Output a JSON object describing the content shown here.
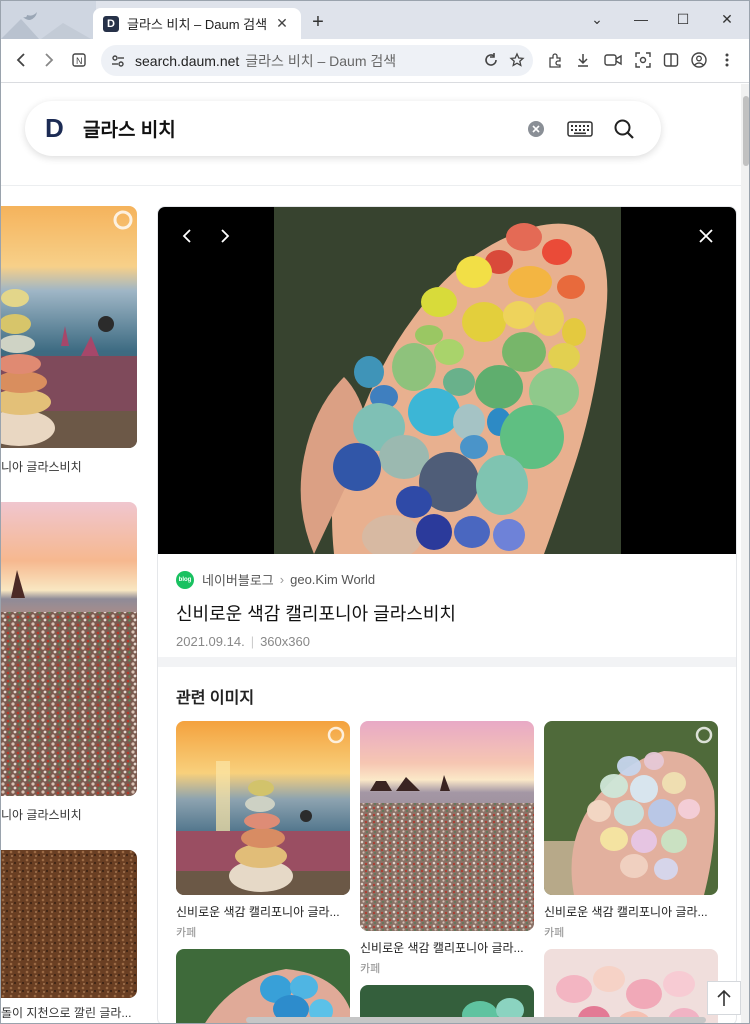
{
  "browser": {
    "tab_title": "글라스 비치 – Daum 검색",
    "tab_favicon_letter": "D",
    "url": "search.daum.net",
    "page_title": "글라스 비치 – Daum 검색",
    "icons": [
      "back-icon",
      "forward-icon",
      "site-icon",
      "reload-icon",
      "bookmark-icon",
      "extensions-icon",
      "download-icon",
      "camera-icon",
      "screenshot-icon",
      "sidebar-icon",
      "profile-icon",
      "menu-icon"
    ]
  },
  "search": {
    "logo": "D",
    "query": "글라스 비치"
  },
  "left_results": [
    {
      "caption": "니아 글라스비치"
    },
    {
      "caption": "니아 글라스비치"
    },
    {
      "caption": "돌이 지천으로 깔린 글라..."
    }
  ],
  "detail": {
    "source_name": "네이버블로그",
    "source_badge": "blog",
    "author": "geo.Kim World",
    "title": "신비로운 색감 캘리포니아 글라스비치",
    "date": "2021.09.14.",
    "size": "360x360"
  },
  "related": {
    "heading": "관련 이미지",
    "items": [
      {
        "caption": "신비로운 색감 캘리포니아 글라...",
        "source": "카페"
      },
      {
        "caption": "신비로운 색감 캘리포니아 글라...",
        "source": "카페"
      },
      {
        "caption": "신비로운 색감 캘리포니아 글라...",
        "source": "카페"
      }
    ]
  },
  "colors": {
    "accent": "#1c2b54",
    "blog_green": "#19c160"
  }
}
